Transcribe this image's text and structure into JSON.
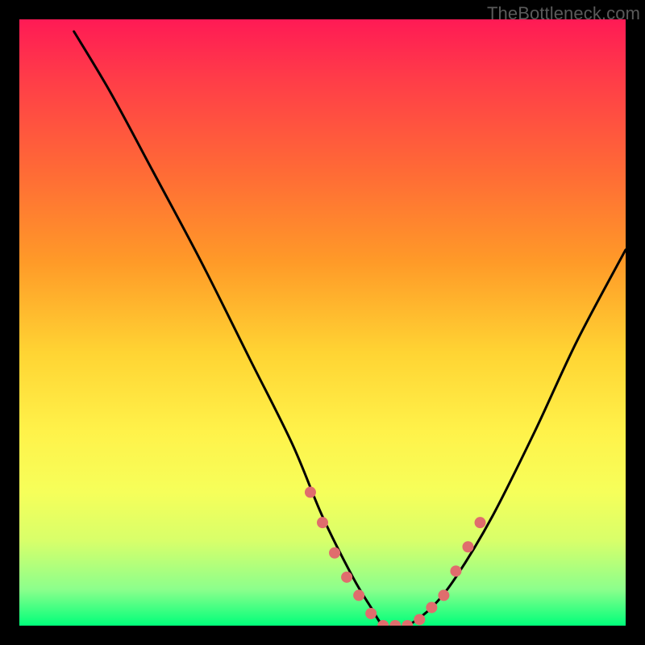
{
  "watermark": "TheBottleneck.com",
  "chart_data": {
    "type": "line",
    "title": "",
    "xlabel": "",
    "ylabel": "",
    "xlim": [
      0,
      100
    ],
    "ylim": [
      0,
      100
    ],
    "grid": false,
    "legend": false,
    "series": [
      {
        "name": "curve",
        "x": [
          9,
          15,
          22,
          30,
          38,
          45,
          50,
          55,
          58,
          60,
          62,
          64,
          68,
          72,
          78,
          85,
          92,
          100
        ],
        "y": [
          98,
          88,
          75,
          60,
          44,
          30,
          18,
          8,
          3,
          0,
          0,
          0,
          3,
          8,
          18,
          32,
          47,
          62
        ]
      }
    ],
    "markers": {
      "name": "highlight-points",
      "color": "#e06d6d",
      "x": [
        48,
        50,
        52,
        54,
        56,
        58,
        60,
        62,
        64,
        66,
        68,
        70,
        72,
        74,
        76
      ],
      "y": [
        22,
        17,
        12,
        8,
        5,
        2,
        0,
        0,
        0,
        1,
        3,
        5,
        9,
        13,
        17
      ]
    },
    "background_gradient": {
      "top": "#ff1a55",
      "bottom": "#00ff7a"
    }
  }
}
